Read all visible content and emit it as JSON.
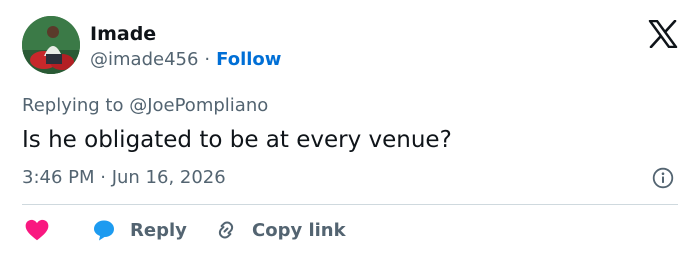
{
  "author": {
    "name": "Imade",
    "handle": "@imade456",
    "separator": "·",
    "follow_label": "Follow"
  },
  "tweet": {
    "replying_to": "Replying to @JoePompliano",
    "text": "Is he obligated to be at every venue?",
    "timestamp": "3:46 PM · Jun 16, 2026"
  },
  "actions": {
    "like_icon": "heart-icon",
    "reply_label": "Reply",
    "copy_label": "Copy link"
  },
  "colors": {
    "follow": "#006fd6",
    "heart": "#f91880",
    "reply_bubble": "#1d9bf0",
    "muted_text": "#536471"
  }
}
